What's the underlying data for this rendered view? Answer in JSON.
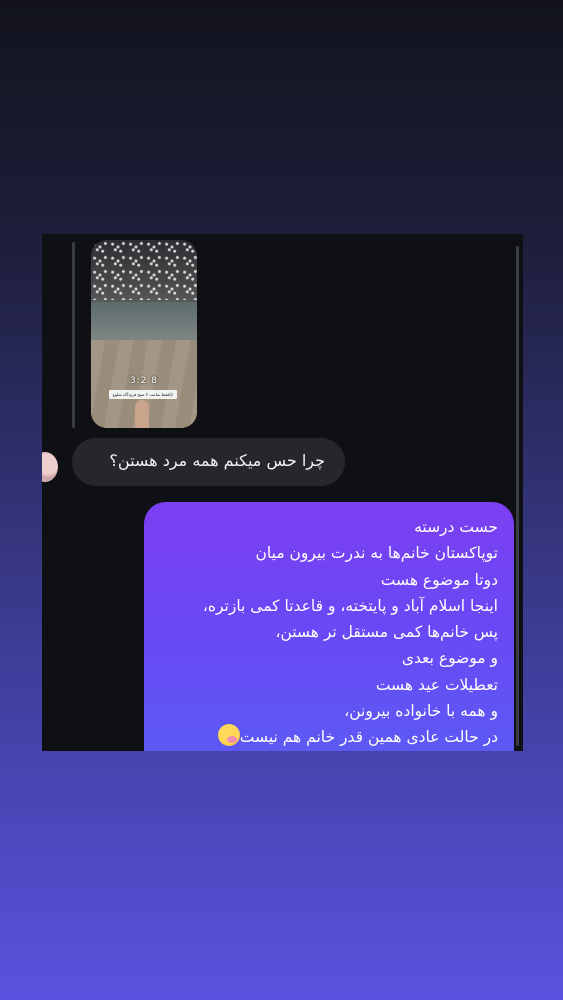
{
  "thread": {
    "shared_media": {
      "time_overlay": "3:2 8",
      "caption_overlay": "فقط ساعت ۳ صبح فرودگاه شلوغ😑"
    },
    "incoming_message": {
      "text": "چرا حس میکنم همه مرد هستن؟"
    },
    "outgoing_message": {
      "lines": [
        "حست درسته",
        "توپاکستان خانم‌ها به ندرت بیرون میان",
        "دوتا موضوع هست",
        "اینجا اسلام آباد و پایتخته، و قاعدتا کمی بازتره،",
        "پس خانم‌ها کمی مستقل تر هستن،",
        "و موضوع بعدی",
        "تعطیلات عید هست",
        "و همه با خانواده بیرونن،",
        "در حالت عادی همین قدر خانم هم نیست"
      ],
      "trailing_emoji": "face-with-hand-over-mouth",
      "bubble_gradient": [
        "#7c3ff2",
        "#5a5cf3"
      ]
    }
  },
  "colors": {
    "page_bg_top": "#12131d",
    "page_bg_bottom": "#5b52e0",
    "chat_bg": "#0f1014",
    "incoming_bubble": "#26272d"
  }
}
